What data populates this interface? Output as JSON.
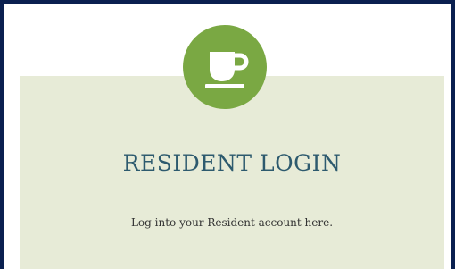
{
  "login_card": {
    "icon": "coffee-cup-icon",
    "title": "RESIDENT LOGIN",
    "subtitle": "Log into your Resident account here."
  },
  "colors": {
    "frame_border": "#0a2050",
    "card_background": "#e7ebd7",
    "badge": "#7aa843",
    "title": "#2d5a6e",
    "body_text": "#333333"
  }
}
